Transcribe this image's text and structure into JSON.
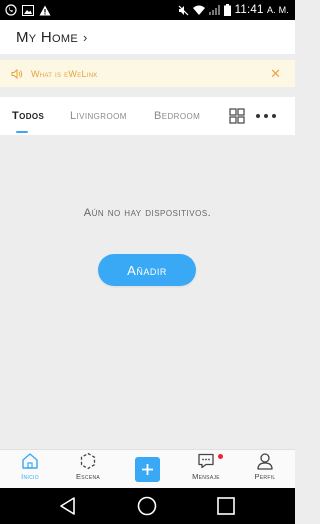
{
  "status_bar": {
    "time": "11:41",
    "ampm": "A. M.",
    "icons": [
      "whatsapp-icon",
      "image-icon",
      "warning-icon",
      "mute-icon",
      "wifi-icon",
      "signal-icon",
      "battery-icon"
    ]
  },
  "header": {
    "title": "My Home"
  },
  "notice": {
    "text": "What is eWeLink"
  },
  "tabs": [
    {
      "label": "Todos",
      "active": true
    },
    {
      "label": "Livingroom",
      "active": false
    },
    {
      "label": "Bedroom",
      "active": false
    }
  ],
  "main": {
    "empty_message": "Aún no hay dispositivos.",
    "add_label": "Añadir"
  },
  "bottom_nav": {
    "items": [
      {
        "label": "Inicio",
        "icon": "home-icon",
        "active": true
      },
      {
        "label": "Escena",
        "icon": "scene-icon",
        "active": false
      },
      {
        "label": "",
        "icon": "plus-icon",
        "active": false
      },
      {
        "label": "Mensaje",
        "icon": "message-icon",
        "active": false,
        "badge": true
      },
      {
        "label": "Perfil",
        "icon": "profile-icon",
        "active": false
      }
    ]
  },
  "colors": {
    "accent": "#39a9f5",
    "notice_bg": "#fdf8e3",
    "notice_text": "#e6a23c",
    "badge": "#f0232e",
    "background": "#ededed"
  }
}
